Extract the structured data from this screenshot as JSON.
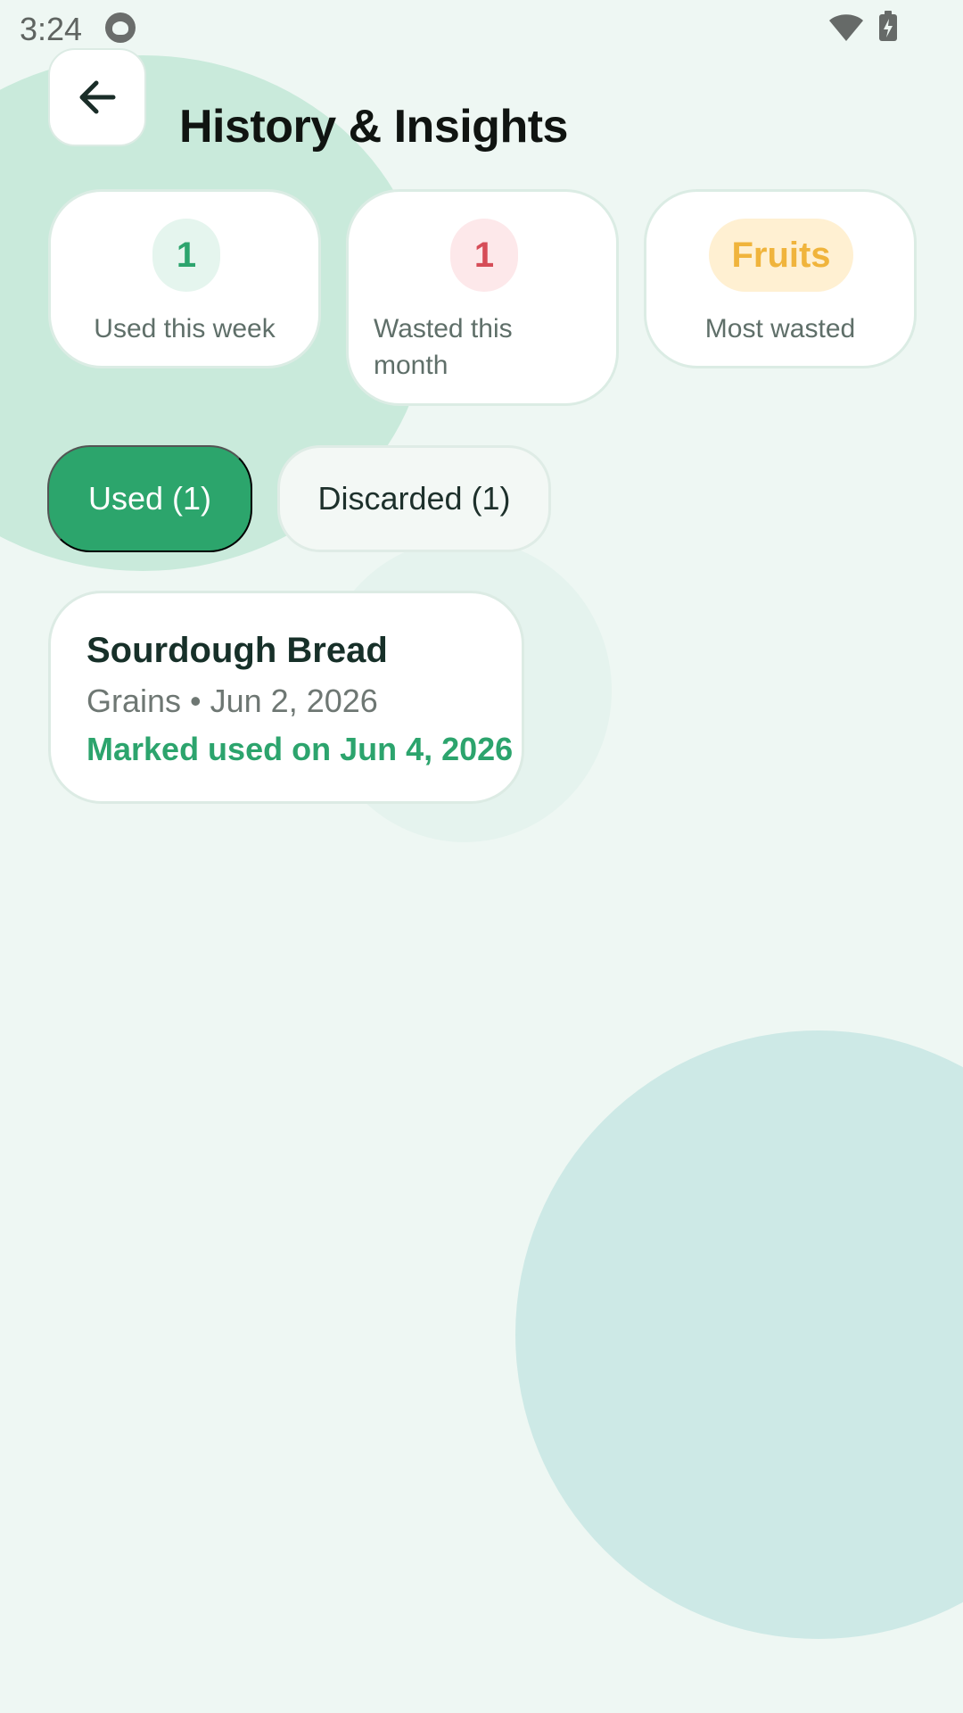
{
  "status_bar": {
    "time": "3:24",
    "icons": [
      "app-notification-icon",
      "wifi-icon",
      "battery-icon"
    ]
  },
  "header": {
    "title": "History & Insights",
    "back_icon": "arrow-left-icon"
  },
  "stats": [
    {
      "value": "1",
      "label": "Used this week",
      "accent": "#2ca46d"
    },
    {
      "value": "1",
      "label": "Wasted this month",
      "accent": "#d64d58"
    },
    {
      "value": "Fruits",
      "label": "Most wasted",
      "accent": "#f0b43c"
    }
  ],
  "filters": [
    {
      "label": "Used (1)",
      "selected": true
    },
    {
      "label": "Discarded (1)",
      "selected": false
    }
  ],
  "history": [
    {
      "title": "Sourdough Bread",
      "category": "Grains",
      "separator": "•",
      "date": "Jun 2, 2026",
      "status": "Marked used on Jun 4, 2026"
    }
  ],
  "colors": {
    "background": "#eef7f3",
    "primary": "#2ca56c",
    "danger": "#d64d58",
    "warning": "#f0b43c"
  }
}
